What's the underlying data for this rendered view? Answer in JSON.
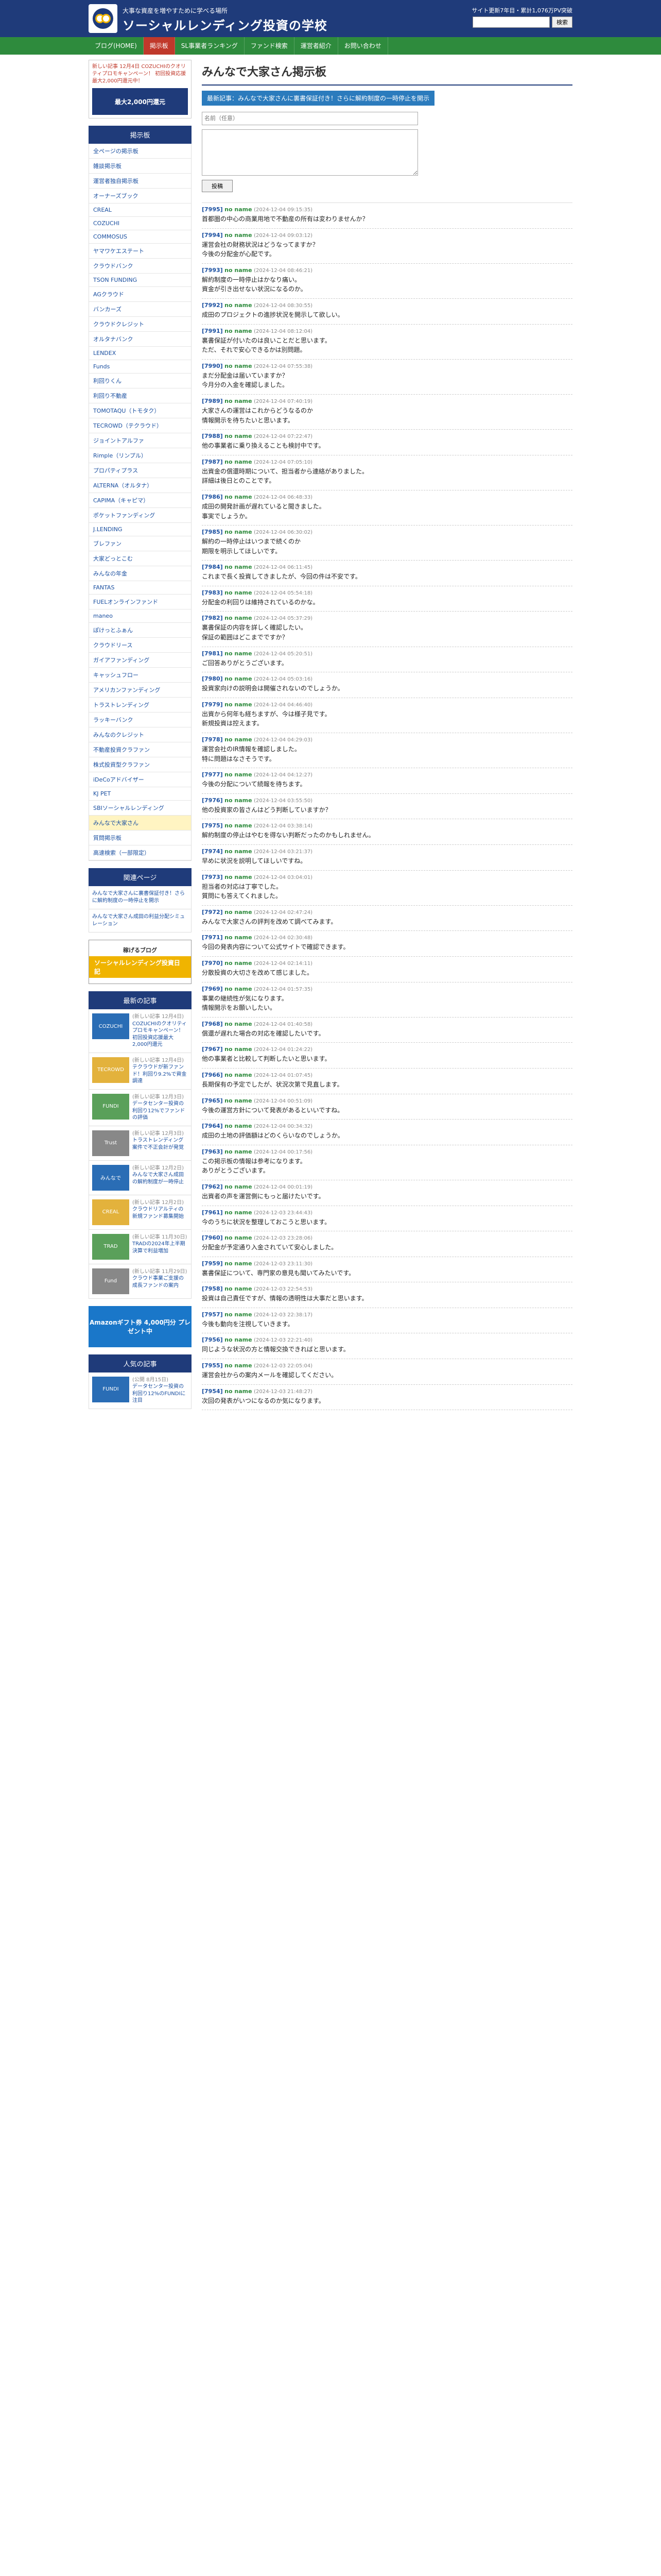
{
  "header": {
    "subtitle": "大事な資産を増やすために学べる場所",
    "title": "ソーシャルレンディング投資の学校",
    "update": "サイト更新7年目・累計1,076万PV突破",
    "search_placeholder": "",
    "search_button": "検索"
  },
  "nav": [
    "ブログ(HOME)",
    "掲示板",
    "SL事業者ランキング",
    "ファンド検索",
    "運営者紹介",
    "お問い合わせ"
  ],
  "sidebar": {
    "ad_text": "新しい記事 12月4日 COZUCHIのクオリティプロモキャンペーン！ 初回投資応援最大2,000円還元中！",
    "ad_banner": "最大2,000円還元",
    "board_head": "掲示板",
    "board_items": [
      "全ページの掲示板",
      "雑談掲示板",
      "運営者独自掲示板",
      "オーナーズブック",
      "CREAL",
      "COZUCHI",
      "COMMOSUS",
      "ヤマワケエステート",
      "クラウドバンク",
      "TSON FUNDING",
      "AGクラウド",
      "バンカーズ",
      "クラウドクレジット",
      "オルタナバンク",
      "LENDEX",
      "Funds",
      "利回りくん",
      "利回り不動産",
      "TOMOTAQU（トモタク）",
      "TECROWD（テクラウド）",
      "ジョイントアルファ",
      "Rimple（リンプル）",
      "プロパティプラス",
      "ALTERNA（オルタナ）",
      "CAPIMA（キャピマ）",
      "ポケットファンディング",
      "J.LENDING",
      "ブレファン",
      "大家どっとこむ",
      "みんなの年金",
      "FANTAS",
      "FUELオンラインファンド",
      "maneo",
      "ぽけっとふぁん",
      "クラウドリース",
      "ガイアファンディング",
      "キャッシュフロー",
      "アメリカンファンディング",
      "トラストレンディング",
      "ラッキーバンク",
      "みんなのクレジット",
      "不動産投資クラファン",
      "株式投資型クラファン",
      "iDeCoアドバイザー",
      "KJ PET",
      "SBIソーシャルレンディング",
      "みんなで大家さん",
      "質問掲示板",
      "高速検索（一部限定）"
    ],
    "current_index": 46,
    "related_head": "関連ページ",
    "related_items": [
      "みんなで大家さんに裏書保証付き！さらに解約制度の一時停止を開示",
      "みんなで大家さん成田の利益分配シミュレーション"
    ],
    "banner_top": "稼げるブログ",
    "banner_bottom": "ソーシャルレンディング投資日記",
    "latest_head": "最新の記事",
    "latest_articles": [
      {
        "date": "(新しい記事 12月4日)",
        "title": "COZUCHIのクオリティプロモキャンペーン！初回投資応援最大2,000円還元",
        "thumb": "COZUCHI"
      },
      {
        "date": "(新しい記事 12月4日)",
        "title": "テクラウドが新ファンド！利回り9.2%で資金調達",
        "thumb": "TECROWD"
      },
      {
        "date": "(新しい記事 12月3日)",
        "title": "データセンター投資の利回り12%でファンドの評価",
        "thumb": "FUNDI"
      },
      {
        "date": "(新しい記事 12月3日)",
        "title": "トラストレンディング案件で不正会計が発覚",
        "thumb": "Trust"
      },
      {
        "date": "(新しい記事 12月2日)",
        "title": "みんなで大家さん成田の解約制度が一時停止",
        "thumb": "みんなで"
      },
      {
        "date": "(新しい記事 12月2日)",
        "title": "クラウドリアルティの新規ファンド募集開始",
        "thumb": "CREAL"
      },
      {
        "date": "(新しい記事 11月30日)",
        "title": "TRADの2024年上半期決算で利益増加",
        "thumb": "TRAD"
      },
      {
        "date": "(新しい記事 11月29日)",
        "title": "クラウド事業ご支援の成長ファンドの案内",
        "thumb": "Fund"
      }
    ],
    "promo": "Amazonギフト券 4,000円分 プレゼント中",
    "popular_head": "人気の記事",
    "popular_articles": [
      {
        "date": "(公開 8月15日)",
        "title": "データセンター投資の利回り12%のFUNDIに注目",
        "thumb": "FUNDI"
      }
    ]
  },
  "main": {
    "title": "みんなで大家さん掲示板",
    "topic": "最新記事：みんなで大家さんに裏書保証付き！さらに解約制度の一時停止を開示",
    "form": {
      "name_placeholder": "名前（任意）",
      "submit": "投稿"
    },
    "posts": [
      {
        "num": "[7995]",
        "name": "no name",
        "date": "(2024-12-04 09:15:35)",
        "body": "首都圏の中心の商業用地で不動産の所有は変わりませんか？"
      },
      {
        "num": "[7994]",
        "name": "no name",
        "date": "(2024-12-04 09:03:12)",
        "body": "運営会社の財務状況はどうなってますか？\n今後の分配金が心配です。"
      },
      {
        "num": "[7993]",
        "name": "no name",
        "date": "(2024-12-04 08:46:21)",
        "body": "解約制度の一時停止はかなり痛い。\n資金が引き出せない状況になるのか。"
      },
      {
        "num": "[7992]",
        "name": "no name",
        "date": "(2024-12-04 08:30:55)",
        "body": "成田のプロジェクトの進捗状況を開示して欲しい。"
      },
      {
        "num": "[7991]",
        "name": "no name",
        "date": "(2024-12-04 08:12:04)",
        "body": "裏書保証が付いたのは良いことだと思います。\nただ、それで安心できるかは別問題。"
      },
      {
        "num": "[7990]",
        "name": "no name",
        "date": "(2024-12-04 07:55:38)",
        "body": "まだ分配金は届いていますか？\n今月分の入金を確認しました。"
      },
      {
        "num": "[7989]",
        "name": "no name",
        "date": "(2024-12-04 07:40:19)",
        "body": "大家さんの運営はこれからどうなるのか\n情報開示を待ちたいと思います。"
      },
      {
        "num": "[7988]",
        "name": "no name",
        "date": "(2024-12-04 07:22:47)",
        "body": "他の事業者に乗り換えることも検討中です。"
      },
      {
        "num": "[7987]",
        "name": "no name",
        "date": "(2024-12-04 07:05:10)",
        "body": "出資金の償還時期について、担当者から連絡がありました。\n詳細は後日とのことです。"
      },
      {
        "num": "[7986]",
        "name": "no name",
        "date": "(2024-12-04 06:48:33)",
        "body": "成田の開発計画が遅れていると聞きました。\n事実でしょうか。"
      },
      {
        "num": "[7985]",
        "name": "no name",
        "date": "(2024-12-04 06:30:02)",
        "body": "解約の一時停止はいつまで続くのか\n期限を明示してほしいです。"
      },
      {
        "num": "[7984]",
        "name": "no name",
        "date": "(2024-12-04 06:11:45)",
        "body": "これまで長く投資してきましたが、今回の件は不安です。"
      },
      {
        "num": "[7983]",
        "name": "no name",
        "date": "(2024-12-04 05:54:18)",
        "body": "分配金の利回りは維持されているのかな。"
      },
      {
        "num": "[7982]",
        "name": "no name",
        "date": "(2024-12-04 05:37:29)",
        "body": "裏書保証の内容を詳しく確認したい。\n保証の範囲はどこまでですか？"
      },
      {
        "num": "[7981]",
        "name": "no name",
        "date": "(2024-12-04 05:20:51)",
        "body": "ご回答ありがとうございます。"
      },
      {
        "num": "[7980]",
        "name": "no name",
        "date": "(2024-12-04 05:03:16)",
        "body": "投資家向けの説明会は開催されないのでしょうか。"
      },
      {
        "num": "[7979]",
        "name": "no name",
        "date": "(2024-12-04 04:46:40)",
        "body": "出資から何年も経ちますが、今は様子見です。\n新規投資は控えます。"
      },
      {
        "num": "[7978]",
        "name": "no name",
        "date": "(2024-12-04 04:29:03)",
        "body": "運営会社のIR情報を確認しました。\n特に問題はなさそうです。"
      },
      {
        "num": "[7977]",
        "name": "no name",
        "date": "(2024-12-04 04:12:27)",
        "body": "今後の分配について続報を待ちます。"
      },
      {
        "num": "[7976]",
        "name": "no name",
        "date": "(2024-12-04 03:55:50)",
        "body": "他の投資家の皆さんはどう判断していますか？"
      },
      {
        "num": "[7975]",
        "name": "no name",
        "date": "(2024-12-04 03:38:14)",
        "body": "解約制度の停止はやむを得ない判断だったのかもしれません。"
      },
      {
        "num": "[7974]",
        "name": "no name",
        "date": "(2024-12-04 03:21:37)",
        "body": "早めに状況を説明してほしいですね。"
      },
      {
        "num": "[7973]",
        "name": "no name",
        "date": "(2024-12-04 03:04:01)",
        "body": "担当者の対応は丁寧でした。\n質問にも答えてくれました。"
      },
      {
        "num": "[7972]",
        "name": "no name",
        "date": "(2024-12-04 02:47:24)",
        "body": "みんなで大家さんの評判を改めて調べてみます。"
      },
      {
        "num": "[7971]",
        "name": "no name",
        "date": "(2024-12-04 02:30:48)",
        "body": "今回の発表内容について公式サイトで確認できます。"
      },
      {
        "num": "[7970]",
        "name": "no name",
        "date": "(2024-12-04 02:14:11)",
        "body": "分散投資の大切さを改めて感じました。"
      },
      {
        "num": "[7969]",
        "name": "no name",
        "date": "(2024-12-04 01:57:35)",
        "body": "事業の継続性が気になります。\n情報開示をお願いしたい。"
      },
      {
        "num": "[7968]",
        "name": "no name",
        "date": "(2024-12-04 01:40:58)",
        "body": "償還が遅れた場合の対応を確認したいです。"
      },
      {
        "num": "[7967]",
        "name": "no name",
        "date": "(2024-12-04 01:24:22)",
        "body": "他の事業者と比較して判断したいと思います。"
      },
      {
        "num": "[7966]",
        "name": "no name",
        "date": "(2024-12-04 01:07:45)",
        "body": "長期保有の予定でしたが、状況次第で見直します。"
      },
      {
        "num": "[7965]",
        "name": "no name",
        "date": "(2024-12-04 00:51:09)",
        "body": "今後の運営方針について発表があるといいですね。"
      },
      {
        "num": "[7964]",
        "name": "no name",
        "date": "(2024-12-04 00:34:32)",
        "body": "成田の土地の評価額はどのくらいなのでしょうか。"
      },
      {
        "num": "[7963]",
        "name": "no name",
        "date": "(2024-12-04 00:17:56)",
        "body": "この掲示板の情報は参考になります。\nありがとうございます。"
      },
      {
        "num": "[7962]",
        "name": "no name",
        "date": "(2024-12-04 00:01:19)",
        "body": "出資者の声を運営側にもっと届けたいです。"
      },
      {
        "num": "[7961]",
        "name": "no name",
        "date": "(2024-12-03 23:44:43)",
        "body": "今のうちに状況を整理しておこうと思います。"
      },
      {
        "num": "[7960]",
        "name": "no name",
        "date": "(2024-12-03 23:28:06)",
        "body": "分配金が予定通り入金されていて安心しました。"
      },
      {
        "num": "[7959]",
        "name": "no name",
        "date": "(2024-12-03 23:11:30)",
        "body": "裏書保証について、専門家の意見も聞いてみたいです。"
      },
      {
        "num": "[7958]",
        "name": "no name",
        "date": "(2024-12-03 22:54:53)",
        "body": "投資は自己責任ですが、情報の透明性は大事だと思います。"
      },
      {
        "num": "[7957]",
        "name": "no name",
        "date": "(2024-12-03 22:38:17)",
        "body": "今後も動向を注視していきます。"
      },
      {
        "num": "[7956]",
        "name": "no name",
        "date": "(2024-12-03 22:21:40)",
        "body": "同じような状況の方と情報交換できればと思います。"
      },
      {
        "num": "[7955]",
        "name": "no name",
        "date": "(2024-12-03 22:05:04)",
        "body": "運営会社からの案内メールを確認してください。"
      },
      {
        "num": "[7954]",
        "name": "no name",
        "date": "(2024-12-03 21:48:27)",
        "body": "次回の発表がいつになるのか気になります。"
      }
    ]
  }
}
